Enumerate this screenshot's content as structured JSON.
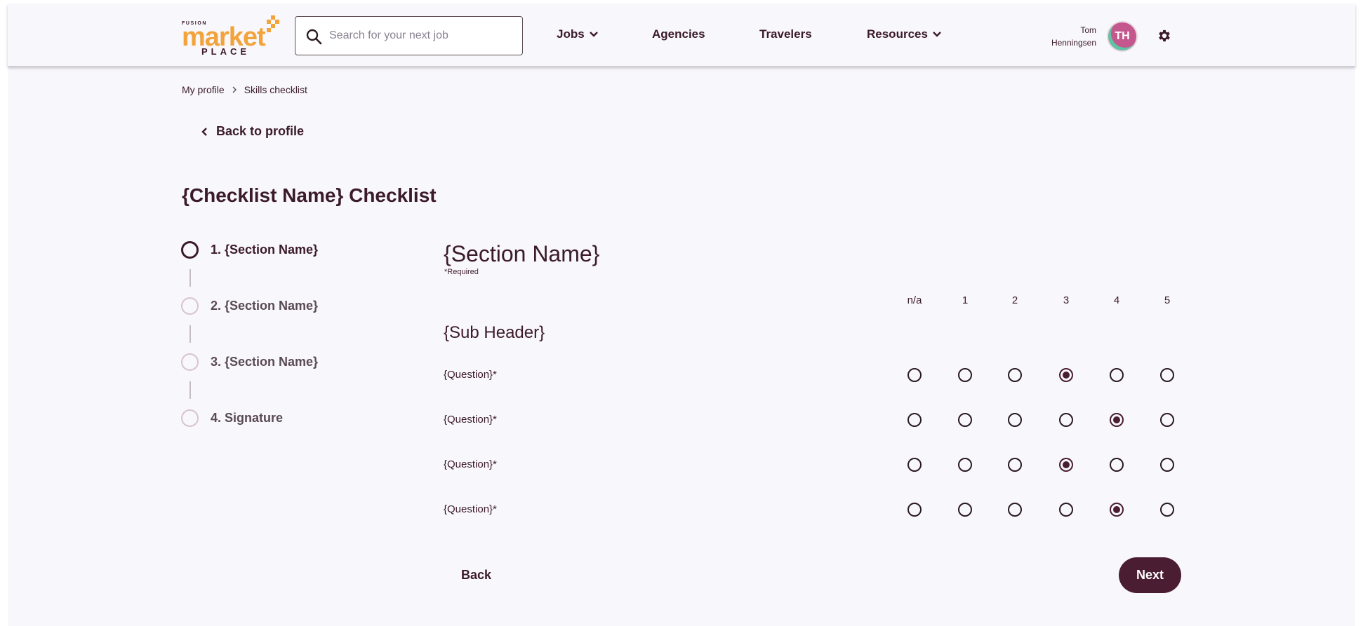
{
  "header": {
    "logo": {
      "top": "FUSION",
      "main": "market",
      "bottom": "PLACE"
    },
    "search": {
      "placeholder": "Search for your next job"
    },
    "nav": [
      {
        "label": "Jobs",
        "has_dropdown": true
      },
      {
        "label": "Agencies",
        "has_dropdown": false
      },
      {
        "label": "Travelers",
        "has_dropdown": false
      },
      {
        "label": "Resources",
        "has_dropdown": true
      }
    ],
    "user": {
      "first_name": "Tom",
      "last_name": "Henningsen",
      "initials": "TH"
    },
    "settings_icon": "gear-icon"
  },
  "breadcrumb": {
    "items": [
      "My profile",
      "Skills checklist"
    ]
  },
  "back_link": "Back to profile",
  "page_title": "{Checklist Name} Checklist",
  "steps": [
    {
      "label": "1. {Section Name}",
      "active": true
    },
    {
      "label": "2. {Section Name}",
      "active": false
    },
    {
      "label": "3. {Section Name}",
      "active": false
    },
    {
      "label": "4. Signature",
      "active": false
    }
  ],
  "section": {
    "title": "{Section Name}",
    "required_note": "*Required",
    "scale": [
      "n/a",
      "1",
      "2",
      "3",
      "4",
      "5"
    ],
    "sub_header": "{Sub Header}",
    "questions": [
      {
        "label": "{Question}*",
        "selected": "3"
      },
      {
        "label": "{Question}*",
        "selected": "4"
      },
      {
        "label": "{Question}*",
        "selected": "3"
      },
      {
        "label": "{Question}*",
        "selected": "4"
      }
    ]
  },
  "buttons": {
    "back": "Back",
    "next": "Next"
  },
  "colors": {
    "brand_orange": "#f2a33a",
    "brand_plum": "#4a1d33",
    "background": "#f8f7fc"
  }
}
